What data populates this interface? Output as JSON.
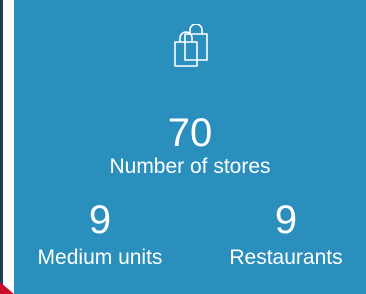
{
  "theme": {
    "card_background": "#2a8fbd",
    "text_color": "#ffffff",
    "accent_marker": "#c8102e",
    "left_edge": "#1d3f55"
  },
  "header": {
    "icon": "shopping-bags-icon"
  },
  "stats": {
    "stores": {
      "value": "70",
      "label": "Number of stores"
    },
    "medium_units": {
      "value": "9",
      "label": "Medium units"
    },
    "restaurants": {
      "value": "9",
      "label": "Restaurants"
    }
  }
}
